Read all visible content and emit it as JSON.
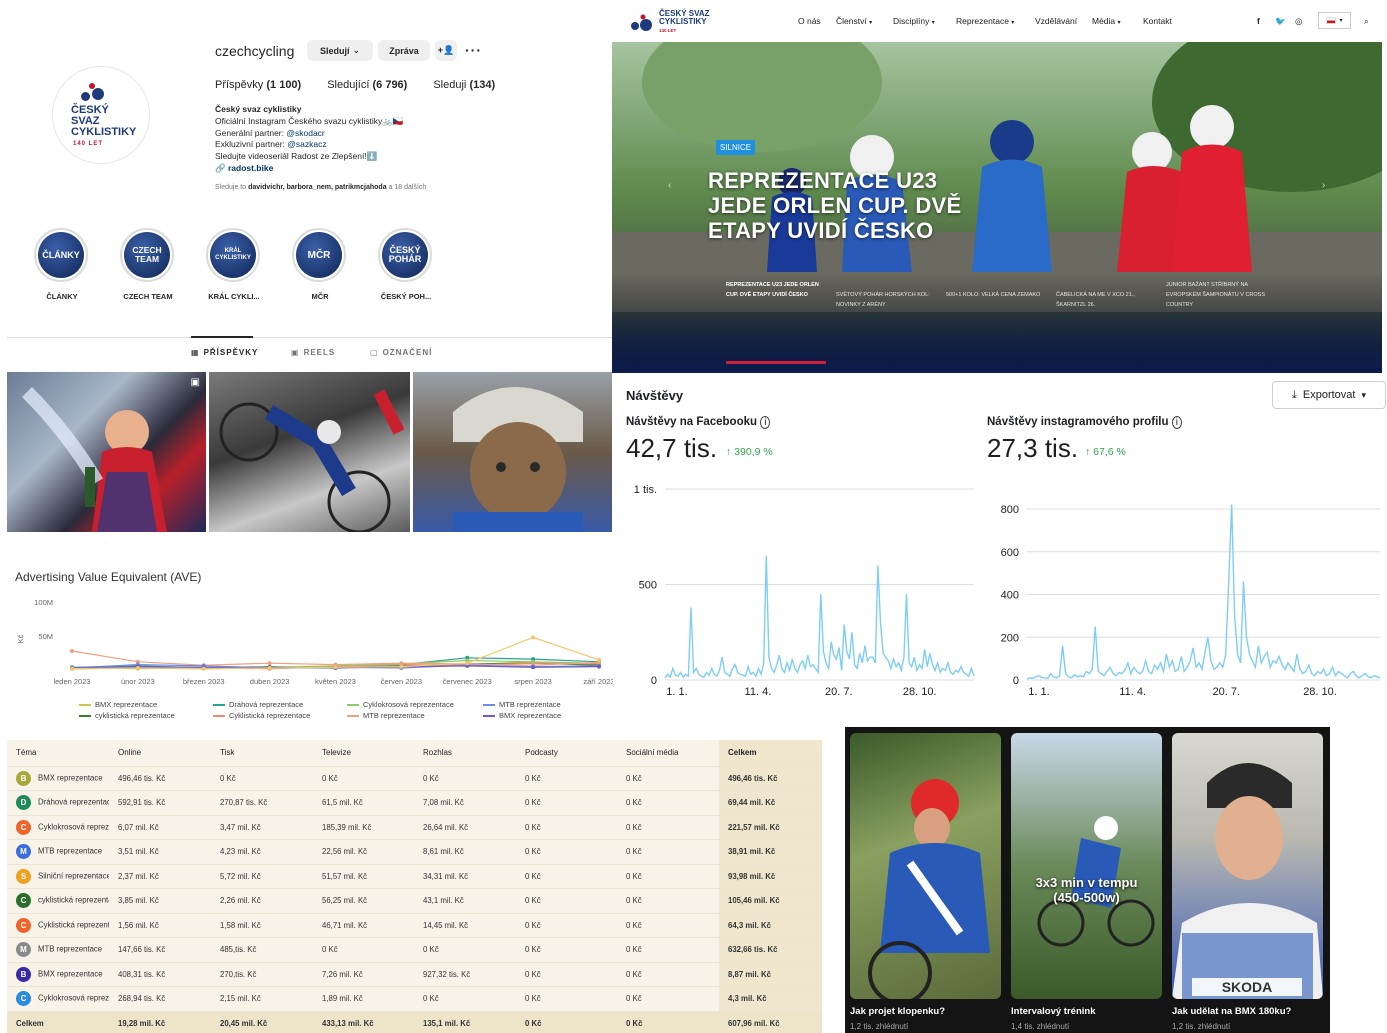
{
  "instagram": {
    "username": "czechcycling",
    "buttons": {
      "follow": "Sledují",
      "message": "Zpráva"
    },
    "stats": {
      "posts_label": "Příspěvky",
      "posts": "(1 100)",
      "followers_label": "Sledující",
      "followers": "(6 796)",
      "following_label": "Sleduji",
      "following": "(134)"
    },
    "logo": {
      "line1": "ČESKÝ",
      "line2": "SVAZ",
      "line3": "CYKLISTIKY",
      "years": "140 LET"
    },
    "bio": {
      "name": "Český svaz cyklistiky",
      "line1": "Oficiální Instagram Českého svazu cyklistiky🚲🇨🇿",
      "line2_prefix": "Generální partner: ",
      "line2_link": "@skodacr",
      "line3_prefix": "Exkluzivní partner: ",
      "line3_link": "@sazkacz",
      "line4": "Sledujte videoseriál Radost ze Zlepšení!⬇️",
      "link": "radost.bike"
    },
    "followed_by": {
      "prefix": "Sleduje to ",
      "names": "davidvichr, barbora_nem, patrikmcjahoda",
      "suffix": " a 18 dalších"
    },
    "highlights": [
      {
        "circle": "ČLÁNKY",
        "label": "ČLÁNKY"
      },
      {
        "circle": "CZECH TEAM",
        "label": "CZECH TEAM"
      },
      {
        "circle": "KRÁL CYKLISTIKY",
        "label": "KRÁL CYKLI..."
      },
      {
        "circle": "MČR",
        "label": "MČR"
      },
      {
        "circle": "ČESKÝ POHÁR",
        "label": "ČESKÝ POH..."
      }
    ],
    "tabs": {
      "posts": "PŘÍSPĚVKY",
      "reels": "REELS",
      "tagged": "OZNAČENÍ"
    }
  },
  "website": {
    "logo": {
      "line1": "ČESKÝ SVAZ",
      "line2": "CYKLISTIKY",
      "years": "140 LET"
    },
    "nav": [
      "O nás",
      "Členství",
      "Disciplíny",
      "Reprezentace",
      "Vzdělávání",
      "Média",
      "Kontakt"
    ],
    "hero": {
      "tag": "SILNICE",
      "title_l1": "REPREZENTACE U23",
      "title_l2": "JEDE ORLEN CUP. DVĚ",
      "title_l3": "ETAPY UVIDÍ ČESKO"
    },
    "news": [
      "REPREZENTACE U23 JEDE ORLEN CUP. DVĚ ETAPY UVIDÍ ČESKO",
      "SVĚTOVÝ POHÁR HORSKÝCH KOL: NOVINKY Z ARÉNY",
      "500+1 KOLO: VELKÁ CENA ZEMAKO",
      "ČABELICKÁ NA ME V XCO 21., ŠKARNITZL 26.",
      "JUNIOR BAŽANT STŘÍBRNÝ NA EVROPSKÉM ŠAMPIONÁTU V CROSS COUNTRY"
    ]
  },
  "visits": {
    "title": "Návštěvy",
    "export": "Exportovat",
    "facebook": {
      "label": "Návštěvy na Facebooku",
      "value": "42,7 tis.",
      "change": "390,9 %"
    },
    "instagram": {
      "label": "Návštěvy instagramového profilu",
      "value": "27,3 tis.",
      "change": "67,6 %"
    }
  },
  "chart_data": [
    {
      "type": "line",
      "title": "Návštěvy na Facebooku",
      "x_ticks": [
        "1. 1.",
        "11. 4.",
        "20. 7.",
        "28. 10."
      ],
      "y_ticks": [
        "0",
        "500",
        "1 tis."
      ],
      "ylim": [
        0,
        1000
      ],
      "color": "#7fcdf5",
      "series": [
        {
          "values": [
            10,
            30,
            15,
            60,
            25,
            20,
            40,
            15,
            30,
            20,
            380,
            40,
            60,
            30,
            20,
            15,
            40,
            25,
            60,
            30,
            20,
            50,
            120,
            40,
            30,
            20,
            60,
            80,
            40,
            30,
            25,
            20,
            70,
            30,
            40,
            20,
            60,
            30,
            90,
            650,
            120,
            60,
            40,
            80,
            130,
            60,
            40,
            90,
            50,
            110,
            60,
            40,
            80,
            100,
            60,
            130,
            70,
            80,
            60,
            40,
            450,
            150,
            90,
            60,
            200,
            130,
            110,
            170,
            50,
            290,
            150,
            110,
            250,
            80,
            60,
            140,
            90,
            180,
            100,
            120,
            120,
            90,
            600,
            300,
            140,
            120,
            100,
            60,
            110,
            70,
            90,
            50,
            120,
            450,
            90,
            70,
            120,
            50,
            80,
            60,
            160,
            70,
            140,
            80,
            50,
            90,
            40,
            60,
            50,
            90,
            40,
            30,
            50,
            40,
            70,
            40,
            30,
            20,
            60,
            20
          ]
        }
      ]
    },
    {
      "type": "line",
      "title": "Návštěvy instagramového profilu",
      "x_ticks": [
        "1. 1.",
        "11. 4.",
        "20. 7.",
        "28. 10."
      ],
      "y_ticks": [
        "0",
        "200",
        "400",
        "600",
        "800"
      ],
      "ylim": [
        0,
        800
      ],
      "color": "#7fcdf5",
      "series": [
        {
          "values": [
            5,
            10,
            8,
            15,
            20,
            12,
            10,
            8,
            30,
            15,
            10,
            20,
            160,
            30,
            15,
            10,
            25,
            15,
            20,
            15,
            40,
            30,
            50,
            250,
            40,
            30,
            20,
            40,
            60,
            30,
            20,
            35,
            30,
            45,
            80,
            30,
            60,
            40,
            30,
            40,
            90,
            40,
            30,
            70,
            50,
            80,
            40,
            120,
            60,
            90,
            40,
            50,
            110,
            40,
            60,
            90,
            150,
            60,
            80,
            50,
            130,
            200,
            90,
            50,
            60,
            80,
            60,
            120,
            460,
            820,
            300,
            120,
            80,
            460,
            200,
            120,
            90,
            60,
            160,
            80,
            110,
            130,
            60,
            90,
            80,
            110,
            70,
            50,
            80,
            60,
            40,
            120,
            50,
            30,
            40,
            70,
            30,
            20,
            40,
            30,
            50,
            20,
            30,
            60,
            20,
            40,
            30,
            20,
            10,
            30,
            40,
            20,
            10,
            20,
            30,
            15,
            10,
            20,
            15,
            10
          ]
        }
      ]
    },
    {
      "type": "line",
      "title": "Advertising Value Equivalent (AVE)",
      "ylabel": "Kč",
      "y_ticks": [
        "100M",
        "50M"
      ],
      "ylim": [
        0,
        100
      ],
      "categories": [
        "leden 2023",
        "únor 2023",
        "březen 2023",
        "duben 2023",
        "květen 2023",
        "červen 2023",
        "červenec 2023",
        "srpen 2023",
        "září 2023"
      ],
      "series": [
        {
          "name": "BMX reprezentace",
          "color": "#c8c84a",
          "values": [
            3,
            4,
            3,
            2,
            5,
            6,
            8,
            12,
            8
          ]
        },
        {
          "name": "cyklistická reprezentace",
          "color": "#3a7d2a",
          "values": [
            2,
            3,
            2,
            3,
            5,
            6,
            9,
            10,
            7
          ]
        },
        {
          "name": "Dráhová reprezentace",
          "color": "#2aa38a",
          "values": [
            4,
            6,
            3,
            5,
            3,
            8,
            18,
            16,
            12
          ]
        },
        {
          "name": "Cyklistická reprezentace",
          "color": "#f08c6e",
          "values": [
            2,
            3,
            3,
            2,
            5,
            8,
            7,
            10,
            9
          ]
        },
        {
          "name": "Cyklokrosová reprezentace",
          "color": "#8ec96e",
          "values": [
            3,
            2,
            3,
            4,
            6,
            9,
            14,
            12,
            10
          ]
        },
        {
          "name": "MTB reprezentace",
          "color": "#f2a07c",
          "values": [
            28,
            12,
            7,
            10,
            8,
            10,
            9,
            7,
            11
          ]
        },
        {
          "name": "MTB reprezentace",
          "color": "#6e8ee0",
          "values": [
            3,
            8,
            6,
            3,
            4,
            3,
            7,
            5,
            6
          ]
        },
        {
          "name": "BMX reprezentace",
          "color": "#6a5acd",
          "values": [
            3,
            5,
            4,
            4,
            3,
            5,
            6,
            4,
            5
          ]
        },
        {
          "name": "",
          "color": "#f5c56e",
          "values": [
            2,
            3,
            2,
            3,
            4,
            5,
            10,
            48,
            15
          ]
        }
      ]
    }
  ],
  "ave": {
    "title": "Advertising Value Equivalent (AVE)",
    "ylabel": "Kč",
    "legend": [
      "BMX reprezentace",
      "cyklistická reprezentace",
      "Dráhová reprezentace",
      "Cyklistická reprezentace",
      "Cyklokrosová reprezentace",
      "MTB reprezentace",
      "MTB reprezentace",
      "BMX reprezentace"
    ]
  },
  "table": {
    "headers": [
      "Téma",
      "Online",
      "Tisk",
      "Televize",
      "Rozhlas",
      "Podcasty",
      "Sociální média",
      "Celkem"
    ],
    "rows": [
      {
        "letter": "B",
        "color": "#a8a83a",
        "cells": [
          "BMX reprezentace",
          "496,46 tis. Kč",
          "0 Kč",
          "0 Kč",
          "0 Kč",
          "0 Kč",
          "0 Kč",
          "496,46 tis. Kč"
        ]
      },
      {
        "letter": "D",
        "color": "#1e8a5a",
        "cells": [
          "Dráhová reprezentace",
          "592,91 tis. Kč",
          "270,87 tis. Kč",
          "61,5 mil. Kč",
          "7,08 mil. Kč",
          "0 Kč",
          "0 Kč",
          "69,44 mil. Kč"
        ]
      },
      {
        "letter": "C",
        "color": "#f0642a",
        "cells": [
          "Cyklokrosová reprezentace",
          "6,07 mil. Kč",
          "3,47 mil. Kč",
          "185,39 mil. Kč",
          "26,64 mil. Kč",
          "0 Kč",
          "0 Kč",
          "221,57 mil. Kč"
        ]
      },
      {
        "letter": "M",
        "color": "#3a6ee0",
        "cells": [
          "MTB reprezentace",
          "3,51 mil. Kč",
          "4,23 mil. Kč",
          "22,56 mil. Kč",
          "8,61 mil. Kč",
          "0 Kč",
          "0 Kč",
          "38,91 mil. Kč"
        ]
      },
      {
        "letter": "S",
        "color": "#f0a020",
        "cells": [
          "Silniční reprezentace",
          "2,37 mil. Kč",
          "5,72 mil. Kč",
          "51,57 mil. Kč",
          "34,31 mil. Kč",
          "0 Kč",
          "0 Kč",
          "93,98 mil. Kč"
        ]
      },
      {
        "letter": "C",
        "color": "#2a6e2a",
        "cells": [
          "cyklistická reprezentace",
          "3,85 mil. Kč",
          "2,26 mil. Kč",
          "56,25 mil. Kč",
          "43,1 mil. Kč",
          "0 Kč",
          "0 Kč",
          "105,46 mil. Kč"
        ]
      },
      {
        "letter": "C",
        "color": "#f0642a",
        "cells": [
          "Cyklistická reprezentace",
          "1,56 mil. Kč",
          "1,58 mil. Kč",
          "46,71 mil. Kč",
          "14,45 mil. Kč",
          "0 Kč",
          "0 Kč",
          "64,3 mil. Kč"
        ]
      },
      {
        "letter": "M",
        "color": "#8a8a8a",
        "cells": [
          "MTB reprezentace",
          "147,66 tis. Kč",
          "485,tis. Kč",
          "0 Kč",
          "0 Kč",
          "0 Kč",
          "0 Kč",
          "632,66 tis. Kč"
        ]
      },
      {
        "letter": "B",
        "color": "#3a2aa8",
        "cells": [
          "BMX reprezentace",
          "408,31 tis. Kč",
          "270,tis. Kč",
          "7,26 mil. Kč",
          "927,32 tis. Kč",
          "0 Kč",
          "0 Kč",
          "8,87 mil. Kč"
        ]
      },
      {
        "letter": "C",
        "color": "#2a8ae0",
        "cells": [
          "Cyklokrosová reprezentace",
          "268,94 tis. Kč",
          "2,15 mil. Kč",
          "1,89 mil. Kč",
          "0 Kč",
          "0 Kč",
          "0 Kč",
          "4,3 mil. Kč"
        ]
      }
    ],
    "total": [
      "Celkem",
      "19,28 mil. Kč",
      "20,45 mil. Kč",
      "433,13 mil. Kč",
      "135,1 mil. Kč",
      "0 Kč",
      "0 Kč",
      "607,96 mil. Kč"
    ]
  },
  "reels": [
    {
      "title": "Jak projet klopenku?",
      "views": "1,2 tis. zhlédnutí",
      "overlay": ""
    },
    {
      "title": "Intervalový trénink",
      "views": "1,4 tis. zhlédnutí",
      "overlay_l1": "3x3 min v tempu",
      "overlay_l2": "(450-500w)"
    },
    {
      "title": "Jak udělat na BMX 180ku?",
      "views": "1,2 tis. zhlédnutí",
      "overlay": ""
    }
  ]
}
